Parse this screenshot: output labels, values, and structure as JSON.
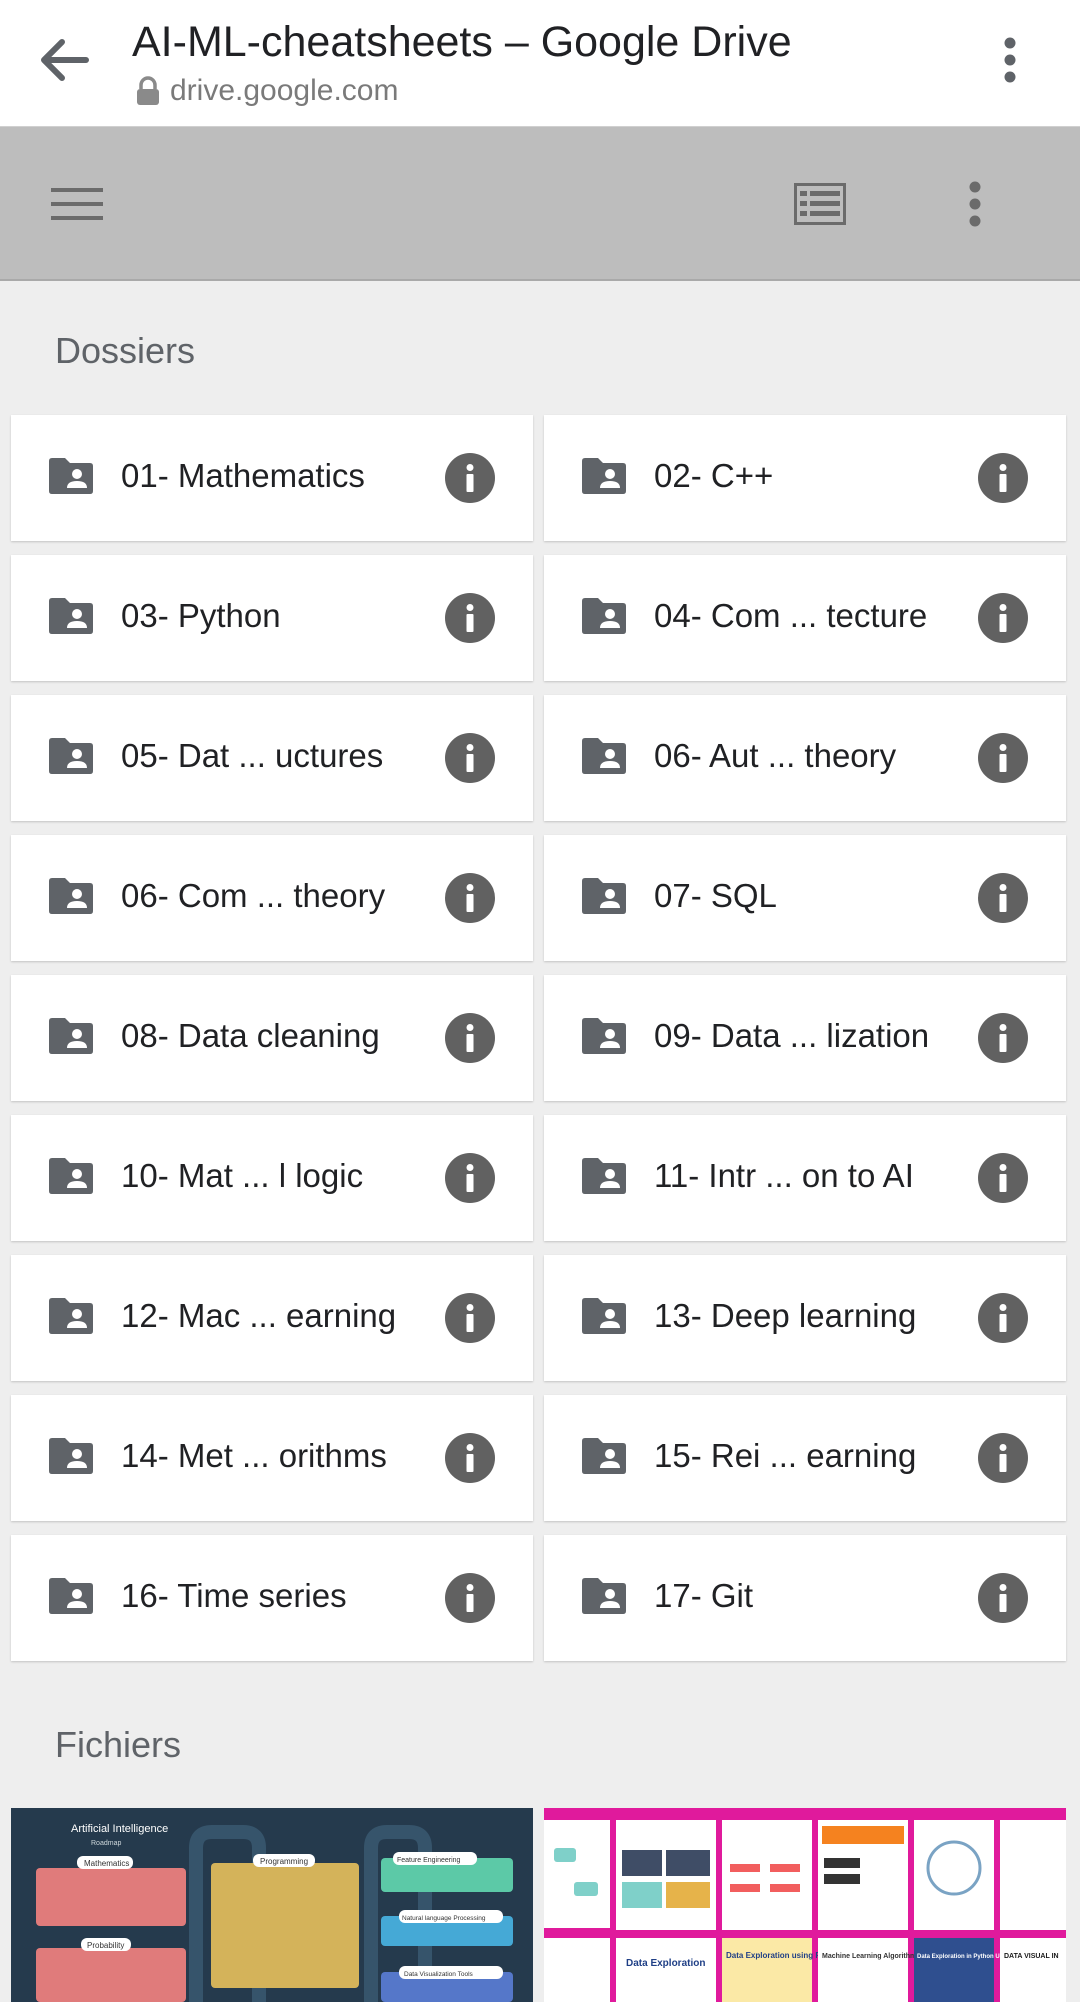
{
  "tab": {
    "title": "AI-ML-cheatsheets – Google Drive",
    "url": "drive.google.com"
  },
  "icons": {
    "back": "arrow-left-icon",
    "lock": "lock-icon",
    "menu": "more-vert-icon",
    "hamburger": "hamburger-menu-icon",
    "list": "list-view-icon",
    "folder": "shared-folder-icon",
    "info": "info-icon"
  },
  "sections": {
    "folders": "Dossiers",
    "files": "Fichiers"
  },
  "folders": [
    {
      "name": "01- Mathematics"
    },
    {
      "name": "02- C++"
    },
    {
      "name": "03- Python"
    },
    {
      "name": "04- Com ... tecture"
    },
    {
      "name": "05- Dat ... uctures"
    },
    {
      "name": "06- Aut ... theory"
    },
    {
      "name": "06- Com ... theory"
    },
    {
      "name": "07- SQL"
    },
    {
      "name": "08- Data cleaning"
    },
    {
      "name": "09- Data ... lization"
    },
    {
      "name": "10- Mat ... l logic"
    },
    {
      "name": "11- Intr ... on to AI"
    },
    {
      "name": "12- Mac ... earning"
    },
    {
      "name": "13- Deep learning"
    },
    {
      "name": "14- Met ... orithms"
    },
    {
      "name": "15- Rei ... earning"
    },
    {
      "name": "16- Time series"
    },
    {
      "name": "17- Git"
    }
  ],
  "files": [
    {
      "heading": "Artificial Intelligence",
      "subheading": "Roadmap",
      "boxes": [
        "Mathematics",
        "Programming",
        "Feature Engineering",
        "Probability",
        "Natural language Processing",
        "Data Visualization Tools"
      ]
    },
    {
      "panels": [
        "Data Exploration",
        "Data Exploration using Pandas",
        "Machine Learning Algorithms",
        "Data Exploration in Python USING",
        "DATA VISUAL IN"
      ]
    }
  ],
  "colors": {
    "toolbar": "#bdbdbd",
    "background": "#eeeeee",
    "info": "#616161",
    "folder_icon": "#5f6368",
    "thumb_ai": "#253a4d",
    "thumb_ds": "#e01a9c"
  }
}
